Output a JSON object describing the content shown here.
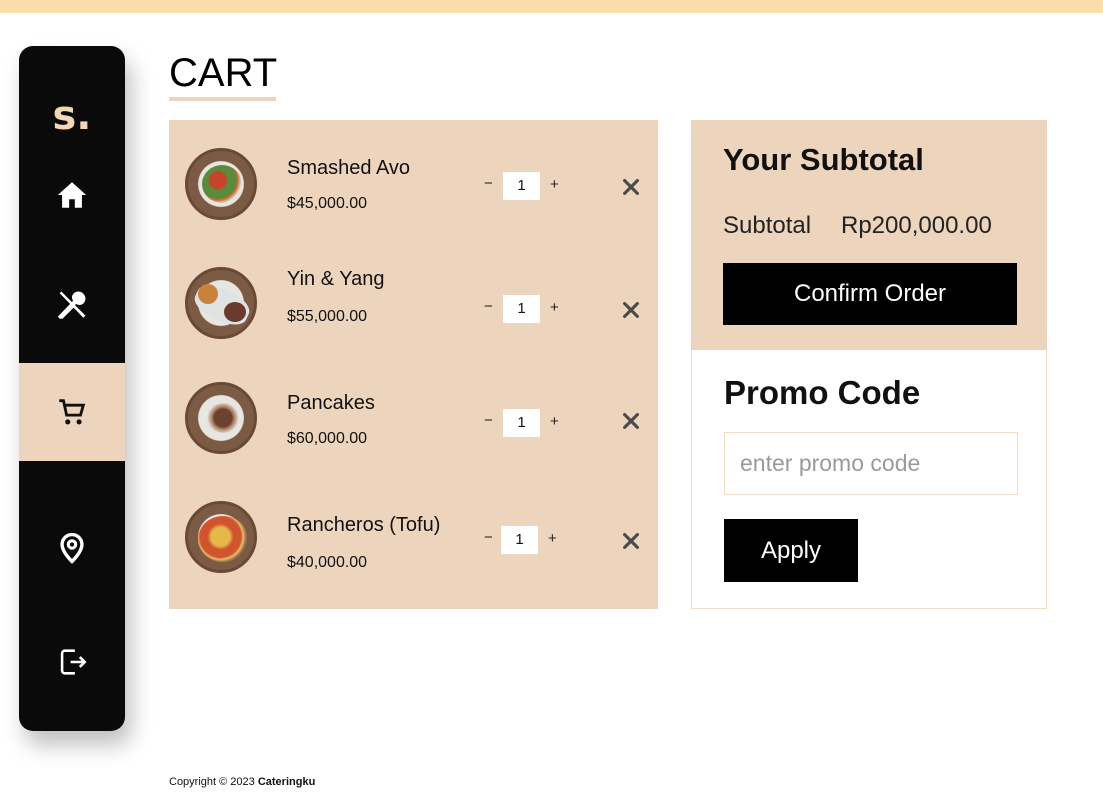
{
  "brand": {
    "logo_text": "s.",
    "logo_color": "#f2d6b5"
  },
  "sidebar": {
    "items": [
      {
        "icon": "home-icon",
        "label": "Home",
        "active": false
      },
      {
        "icon": "utensils-icon",
        "label": "Menu",
        "active": false
      },
      {
        "icon": "cart-icon",
        "label": "Cart",
        "active": true
      },
      {
        "icon": "location-icon",
        "label": "Location",
        "active": false
      },
      {
        "icon": "logout-icon",
        "label": "Logout",
        "active": false
      }
    ]
  },
  "page": {
    "title": "CART"
  },
  "cart": {
    "items": [
      {
        "name": "Smashed Avo",
        "price": "$45,000.00",
        "quantity": "1"
      },
      {
        "name": "Yin & Yang",
        "price": "$55,000.00",
        "quantity": "1"
      },
      {
        "name": "Pancakes",
        "price": "$60,000.00",
        "quantity": "1"
      },
      {
        "name": "Rancheros (Tofu)",
        "price": "$40,000.00",
        "quantity": "1"
      }
    ],
    "minus_symbol": "−",
    "plus_symbol": "+"
  },
  "summary": {
    "heading": "Your Subtotal",
    "subtotal_label": "Subtotal",
    "subtotal_value": "Rp200,000.00",
    "confirm_label": "Confirm Order"
  },
  "promo": {
    "heading": "Promo Code",
    "placeholder": "enter promo code",
    "value": "",
    "apply_label": "Apply"
  },
  "footer": {
    "copyright": "Copyright © 2023 ",
    "brand": "Cateringku"
  },
  "colors": {
    "accent": "#edd5bd",
    "top_strip": "#fbdcad",
    "sidebar_bg": "#0a0a0a",
    "button_bg": "#000000"
  }
}
